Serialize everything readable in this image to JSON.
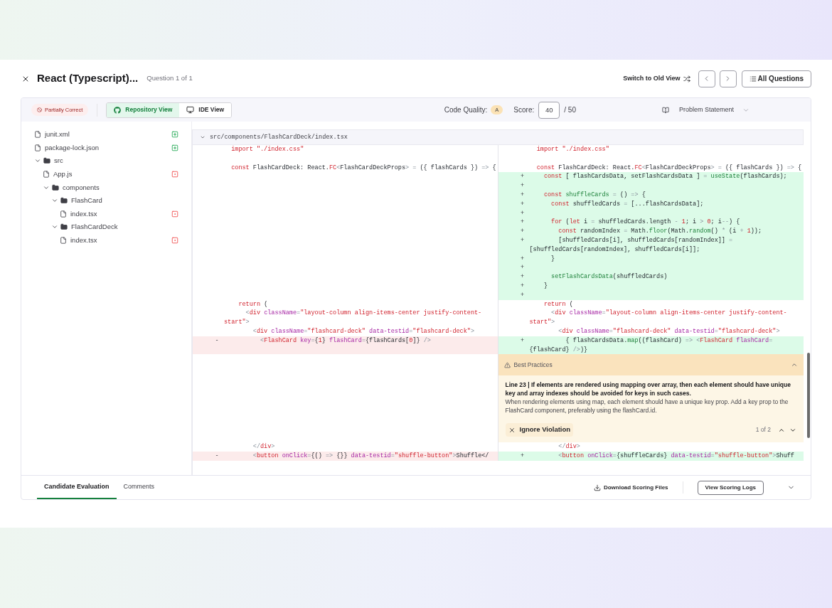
{
  "header": {
    "title": "React (Typescript)...",
    "subtitle": "Question 1 of 1",
    "switch_label": "Switch to Old View",
    "all_questions": "All Questions"
  },
  "toolbar": {
    "status": "Partially Correct",
    "views": [
      {
        "label": "Repository View",
        "selected": true
      },
      {
        "label": "IDE View",
        "selected": false
      }
    ],
    "code_quality_label": "Code Quality:",
    "code_quality_grade": "A",
    "score_label": "Score:",
    "score": "40",
    "score_max": "/ 50",
    "problem_statement": "Problem Statement"
  },
  "file_tree": [
    {
      "name": "junit.xml",
      "kind": "file",
      "added": true
    },
    {
      "name": "package-lock.json",
      "kind": "file",
      "added": true
    },
    {
      "name": "src",
      "kind": "folder",
      "expanded": true,
      "children": [
        {
          "name": "App.js",
          "kind": "file",
          "added": false
        },
        {
          "name": "components",
          "kind": "folder",
          "expanded": true,
          "children": [
            {
              "name": "FlashCard",
              "kind": "folder",
              "expanded": true,
              "children": [
                {
                  "name": "index.tsx",
                  "kind": "file",
                  "added": false
                }
              ]
            },
            {
              "name": "FlashCardDeck",
              "kind": "folder",
              "expanded": true,
              "children": [
                {
                  "name": "index.tsx",
                  "kind": "file",
                  "added": false
                }
              ]
            }
          ]
        }
      ]
    }
  ],
  "diff": {
    "path": "src/components/FlashCardDeck/index.tsx",
    "expanded": true,
    "rows": [
      {
        "left": {
          "kind": "context",
          "tokens": [
            {
              "kind": "kw",
              "text": "  import "
            },
            {
              "kind": "kw",
              "text": "\"./index.css\""
            }
          ]
        },
        "right": {
          "kind": "context",
          "tokens": [
            {
              "kind": "kw",
              "text": "  import "
            },
            {
              "kind": "kw",
              "text": "\"./index.css\""
            }
          ]
        }
      },
      {
        "left": {
          "kind": "context"
        },
        "right": {
          "kind": "context"
        }
      },
      {
        "left": {
          "kind": "context",
          "tokens": [
            {
              "kind": "kw",
              "text": "  const "
            },
            {
              "kind": "plain",
              "text": "FlashCardDeck: React."
            },
            {
              "kind": "kw",
              "text": "FC"
            },
            {
              "kind": "op",
              "text": "<"
            },
            {
              "kind": "plain",
              "text": "FlashCardDeckProps"
            },
            {
              "kind": "op",
              "text": "> = "
            },
            {
              "kind": "plain",
              "text": "({ flashCards }) "
            },
            {
              "kind": "op",
              "text": "=>"
            },
            {
              "kind": "plain",
              "text": " {"
            }
          ]
        },
        "right": {
          "kind": "context",
          "tokens": [
            {
              "kind": "kw",
              "text": "  const "
            },
            {
              "kind": "plain",
              "text": "FlashCardDeck: React."
            },
            {
              "kind": "kw",
              "text": "FC"
            },
            {
              "kind": "op",
              "text": "<"
            },
            {
              "kind": "plain",
              "text": "FlashCardDeckProps"
            },
            {
              "kind": "op",
              "text": "> = "
            },
            {
              "kind": "plain",
              "text": "({ flashCards }) "
            },
            {
              "kind": "op",
              "text": "=>"
            },
            {
              "kind": "plain",
              "text": " {"
            }
          ]
        }
      },
      {
        "left": {
          "kind": "empty"
        },
        "right": {
          "kind": "added",
          "sign": "+",
          "tokens": [
            {
              "kind": "kw",
              "text": "    const "
            },
            {
              "kind": "plain",
              "text": "[ flashCardsData, setFlashCardsData ] "
            },
            {
              "kind": "op",
              "text": "= "
            },
            {
              "kind": "fn",
              "text": "useState"
            },
            {
              "kind": "plain",
              "text": "(flashCards);"
            }
          ]
        }
      },
      {
        "left": {
          "kind": "empty"
        },
        "right": {
          "kind": "added",
          "sign": "+"
        }
      },
      {
        "left": {
          "kind": "empty"
        },
        "right": {
          "kind": "added",
          "sign": "+",
          "tokens": [
            {
              "kind": "kw",
              "text": "    const "
            },
            {
              "kind": "fn",
              "text": "shuffleCards"
            },
            {
              "kind": "op",
              "text": " = "
            },
            {
              "kind": "plain",
              "text": "() "
            },
            {
              "kind": "op",
              "text": "=> "
            },
            {
              "kind": "plain",
              "text": "{"
            }
          ]
        }
      },
      {
        "left": {
          "kind": "empty"
        },
        "right": {
          "kind": "added",
          "sign": "+",
          "tokens": [
            {
              "kind": "kw",
              "text": "      const "
            },
            {
              "kind": "plain",
              "text": "shuffledCards "
            },
            {
              "kind": "op",
              "text": "= "
            },
            {
              "kind": "plain",
              "text": "[...flashCardsData];"
            }
          ]
        }
      },
      {
        "left": {
          "kind": "empty"
        },
        "right": {
          "kind": "added",
          "sign": "+"
        }
      },
      {
        "left": {
          "kind": "empty"
        },
        "right": {
          "kind": "added",
          "sign": "+",
          "tokens": [
            {
              "kind": "kw",
              "text": "      for "
            },
            {
              "kind": "plain",
              "text": "("
            },
            {
              "kind": "kw",
              "text": "let "
            },
            {
              "kind": "plain",
              "text": "i "
            },
            {
              "kind": "op",
              "text": "= "
            },
            {
              "kind": "plain",
              "text": "shuffledCards.length "
            },
            {
              "kind": "op",
              "text": "- "
            },
            {
              "kind": "kw",
              "text": "1"
            },
            {
              "kind": "plain",
              "text": "; i "
            },
            {
              "kind": "op",
              "text": "> "
            },
            {
              "kind": "kw",
              "text": "0"
            },
            {
              "kind": "plain",
              "text": "; i"
            },
            {
              "kind": "op",
              "text": "--"
            },
            {
              "kind": "plain",
              "text": ") {"
            }
          ]
        }
      },
      {
        "left": {
          "kind": "empty"
        },
        "right": {
          "kind": "added",
          "sign": "+",
          "tokens": [
            {
              "kind": "kw",
              "text": "        const "
            },
            {
              "kind": "plain",
              "text": "randomIndex "
            },
            {
              "kind": "op",
              "text": "= "
            },
            {
              "kind": "plain",
              "text": "Math."
            },
            {
              "kind": "fn",
              "text": "floor"
            },
            {
              "kind": "plain",
              "text": "(Math."
            },
            {
              "kind": "fn",
              "text": "random"
            },
            {
              "kind": "plain",
              "text": "() "
            },
            {
              "kind": "op",
              "text": "* "
            },
            {
              "kind": "plain",
              "text": "(i "
            },
            {
              "kind": "op",
              "text": "+ "
            },
            {
              "kind": "kw",
              "text": "1"
            },
            {
              "kind": "plain",
              "text": "));"
            }
          ]
        }
      },
      {
        "left": {
          "kind": "empty"
        },
        "right": {
          "kind": "added",
          "sign": "+",
          "tokens": [
            {
              "kind": "plain",
              "text": "        [shuffledCards[i], shuffledCards[randomIndex]] "
            },
            {
              "kind": "op",
              "text": "= "
            },
            {
              "kind": "plain",
              "text": "[shuffledCards[randomIndex], shuffledCards[i]];"
            }
          ]
        }
      },
      {
        "left": {
          "kind": "empty"
        },
        "right": {
          "kind": "added",
          "sign": "+",
          "tokens": [
            {
              "kind": "plain",
              "text": "      }"
            }
          ]
        }
      },
      {
        "left": {
          "kind": "empty"
        },
        "right": {
          "kind": "added",
          "sign": "+"
        }
      },
      {
        "left": {
          "kind": "empty"
        },
        "right": {
          "kind": "added",
          "sign": "+",
          "tokens": [
            {
              "kind": "fn",
              "text": "      setFlashCardsData"
            },
            {
              "kind": "plain",
              "text": "(shuffledCards)"
            }
          ]
        }
      },
      {
        "left": {
          "kind": "empty"
        },
        "right": {
          "kind": "added",
          "sign": "+",
          "tokens": [
            {
              "kind": "plain",
              "text": "    }"
            }
          ]
        }
      },
      {
        "left": {
          "kind": "empty"
        },
        "right": {
          "kind": "added",
          "sign": "+"
        }
      },
      {
        "left": {
          "kind": "context",
          "tokens": [
            {
              "kind": "kw",
              "text": "    return "
            },
            {
              "kind": "plain",
              "text": "("
            }
          ]
        },
        "right": {
          "kind": "context",
          "tokens": [
            {
              "kind": "kw",
              "text": "    return "
            },
            {
              "kind": "plain",
              "text": "("
            }
          ]
        }
      },
      {
        "left": {
          "kind": "context",
          "tokens": [
            {
              "kind": "op",
              "text": "      <"
            },
            {
              "kind": "kw",
              "text": "div "
            },
            {
              "kind": "attr",
              "text": "className"
            },
            {
              "kind": "op",
              "text": "="
            },
            {
              "kind": "kw",
              "text": "\"layout-column align-items-center justify-content-start\""
            },
            {
              "kind": "op",
              "text": ">"
            }
          ]
        },
        "right": {
          "kind": "context",
          "tokens": [
            {
              "kind": "op",
              "text": "      <"
            },
            {
              "kind": "kw",
              "text": "div "
            },
            {
              "kind": "attr",
              "text": "className"
            },
            {
              "kind": "op",
              "text": "="
            },
            {
              "kind": "kw",
              "text": "\"layout-column align-items-center justify-content-start\""
            },
            {
              "kind": "op",
              "text": ">"
            }
          ]
        }
      },
      {
        "left": {
          "kind": "context",
          "tokens": [
            {
              "kind": "op",
              "text": "        <"
            },
            {
              "kind": "kw",
              "text": "div "
            },
            {
              "kind": "attr",
              "text": "className"
            },
            {
              "kind": "op",
              "text": "="
            },
            {
              "kind": "kw",
              "text": "\"flashcard-deck\" "
            },
            {
              "kind": "attr",
              "text": "data-testid"
            },
            {
              "kind": "op",
              "text": "="
            },
            {
              "kind": "kw",
              "text": "\"flashcard-deck\""
            },
            {
              "kind": "op",
              "text": ">"
            }
          ]
        },
        "right": {
          "kind": "context",
          "tokens": [
            {
              "kind": "op",
              "text": "        <"
            },
            {
              "kind": "kw",
              "text": "div "
            },
            {
              "kind": "attr",
              "text": "className"
            },
            {
              "kind": "op",
              "text": "="
            },
            {
              "kind": "kw",
              "text": "\"flashcard-deck\" "
            },
            {
              "kind": "attr",
              "text": "data-testid"
            },
            {
              "kind": "op",
              "text": "="
            },
            {
              "kind": "kw",
              "text": "\"flashcard-deck\""
            },
            {
              "kind": "op",
              "text": ">"
            }
          ]
        }
      },
      {
        "left": {
          "kind": "removed",
          "sign": "-",
          "tokens": [
            {
              "kind": "op",
              "text": "          <"
            },
            {
              "kind": "kw",
              "text": "FlashCard "
            },
            {
              "kind": "attr",
              "text": "key"
            },
            {
              "kind": "op",
              "text": "="
            },
            {
              "kind": "plain",
              "text": "{"
            },
            {
              "kind": "kw",
              "text": "1"
            },
            {
              "kind": "plain",
              "text": "} "
            },
            {
              "kind": "attr",
              "text": "flashCard"
            },
            {
              "kind": "op",
              "text": "="
            },
            {
              "kind": "plain",
              "text": "{flashCards["
            },
            {
              "kind": "kw",
              "text": "0"
            },
            {
              "kind": "plain",
              "text": "]} "
            },
            {
              "kind": "op",
              "text": "/>"
            }
          ]
        },
        "right": {
          "kind": "added",
          "sign": "+",
          "tokens": [
            {
              "kind": "plain",
              "text": "          { flashCardsData."
            },
            {
              "kind": "fn",
              "text": "map"
            },
            {
              "kind": "plain",
              "text": "((flashCard) "
            },
            {
              "kind": "op",
              "text": "=> <"
            },
            {
              "kind": "kw",
              "text": "FlashCard "
            },
            {
              "kind": "attr",
              "text": "flashCard"
            },
            {
              "kind": "op",
              "text": "="
            },
            {
              "kind": "plain",
              "text": "{flashCard} "
            },
            {
              "kind": "op",
              "text": "/>"
            },
            {
              "kind": "plain",
              "text": ")}"
            }
          ]
        }
      },
      {
        "left": {
          "kind": "empty"
        },
        "right": {
          "kind": "annotation",
          "title": "Best Practices",
          "expanded": true,
          "heading": "Line 23 | If elements are rendered using mapping over array, then each element should have unique key and array indexes should be avoided for keys in such cases.",
          "body": "When rendering elements using map, each element should have a unique key prop. Add a key prop to the FlashCard component, preferably using the flashCard.id.",
          "ignore_label": "Ignore Violation",
          "counter": "1 of 2"
        }
      },
      {
        "left": {
          "kind": "context",
          "tokens": [
            {
              "kind": "op",
              "text": "        </"
            },
            {
              "kind": "kw",
              "text": "div"
            },
            {
              "kind": "op",
              "text": ">"
            }
          ]
        },
        "right": {
          "kind": "context",
          "tokens": [
            {
              "kind": "op",
              "text": "        </"
            },
            {
              "kind": "kw",
              "text": "div"
            },
            {
              "kind": "op",
              "text": ">"
            }
          ]
        }
      },
      {
        "left": {
          "kind": "removed",
          "sign": "-",
          "tokens": [
            {
              "kind": "op",
              "text": "        <"
            },
            {
              "kind": "kw",
              "text": "button "
            },
            {
              "kind": "attr",
              "text": "onClick"
            },
            {
              "kind": "op",
              "text": "="
            },
            {
              "kind": "plain",
              "text": "{() "
            },
            {
              "kind": "op",
              "text": "=> "
            },
            {
              "kind": "plain",
              "text": "{}} "
            },
            {
              "kind": "attr",
              "text": "data-testid"
            },
            {
              "kind": "op",
              "text": "="
            },
            {
              "kind": "kw",
              "text": "\"shuffle-button\""
            },
            {
              "kind": "op",
              "text": ">"
            },
            {
              "kind": "plain",
              "text": "Shuffle</"
            }
          ]
        },
        "right": {
          "kind": "added",
          "sign": "+",
          "tokens": [
            {
              "kind": "op",
              "text": "        <"
            },
            {
              "kind": "kw",
              "text": "button "
            },
            {
              "kind": "attr",
              "text": "onClick"
            },
            {
              "kind": "op",
              "text": "="
            },
            {
              "kind": "plain",
              "text": "{shuffleCards} "
            },
            {
              "kind": "attr",
              "text": "data-testid"
            },
            {
              "kind": "op",
              "text": "="
            },
            {
              "kind": "kw",
              "text": "\"shuffle-button\""
            },
            {
              "kind": "op",
              "text": ">"
            },
            {
              "kind": "plain",
              "text": "Shuff"
            }
          ]
        }
      }
    ]
  },
  "footer": {
    "tabs": [
      {
        "label": "Candidate Evaluation",
        "selected": true
      },
      {
        "label": "Comments",
        "selected": false
      }
    ],
    "download": "Download Scoring Files",
    "view_logs": "View Scoring Logs"
  }
}
